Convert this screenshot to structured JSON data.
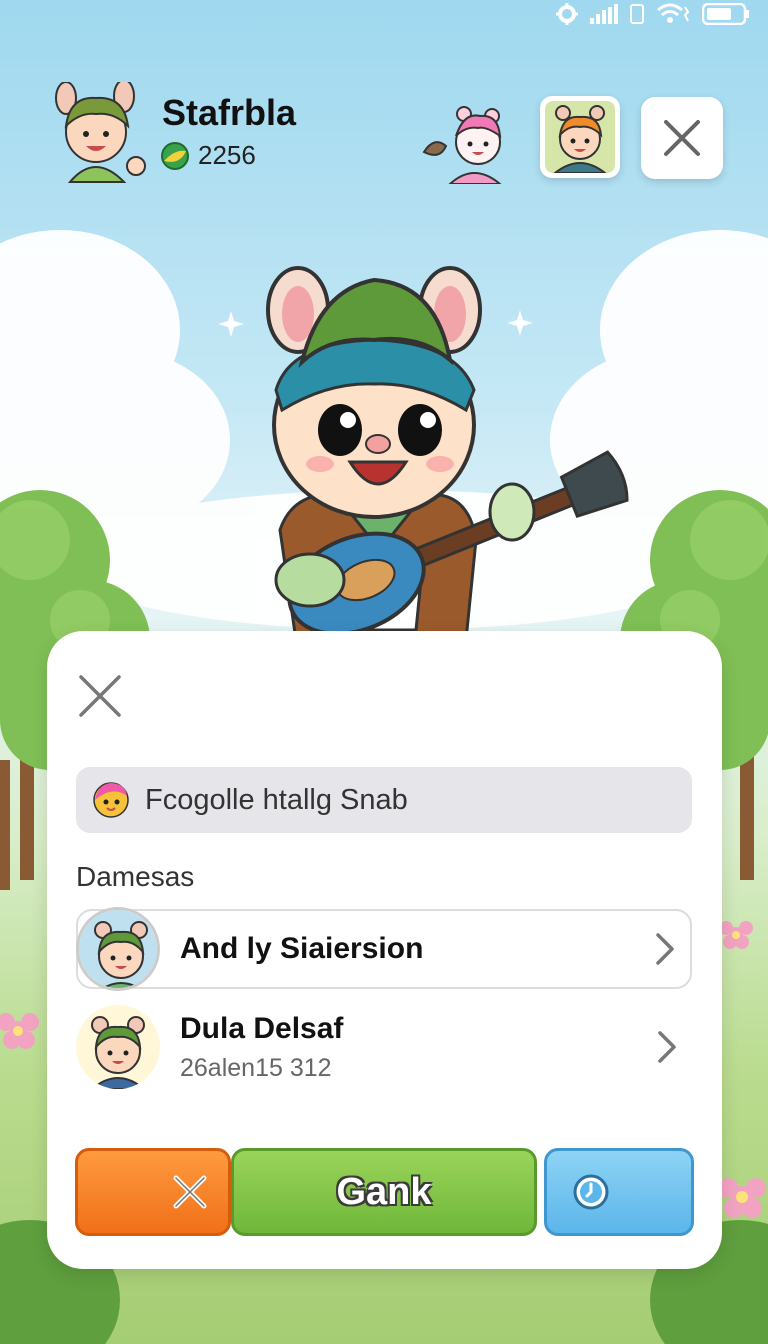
{
  "header": {
    "player_name": "Stafrbla",
    "coins": "2256"
  },
  "panel": {
    "search_text": "Fcogolle htallg Snab",
    "section_label": "Damesas",
    "items": [
      {
        "title": "And ly Siaiersion",
        "subtitle": ""
      },
      {
        "title": "Dula Delsaf",
        "subtitle": "26alen15 312"
      }
    ],
    "main_button": "Gank"
  },
  "icons": {
    "status": [
      "gear-icon",
      "signal-icon",
      "sim-icon",
      "wifi-icon",
      "battery-icon"
    ],
    "coin": "green-coin-icon",
    "close": "close-icon",
    "timer": "clock-icon",
    "cancel": "cross-icon"
  },
  "colors": {
    "sky": "#9fd8ef",
    "grass": "#a5cd73",
    "cancel_button": "#f07018",
    "main_button": "#6fb73a",
    "timer_button": "#5bb6ea"
  }
}
